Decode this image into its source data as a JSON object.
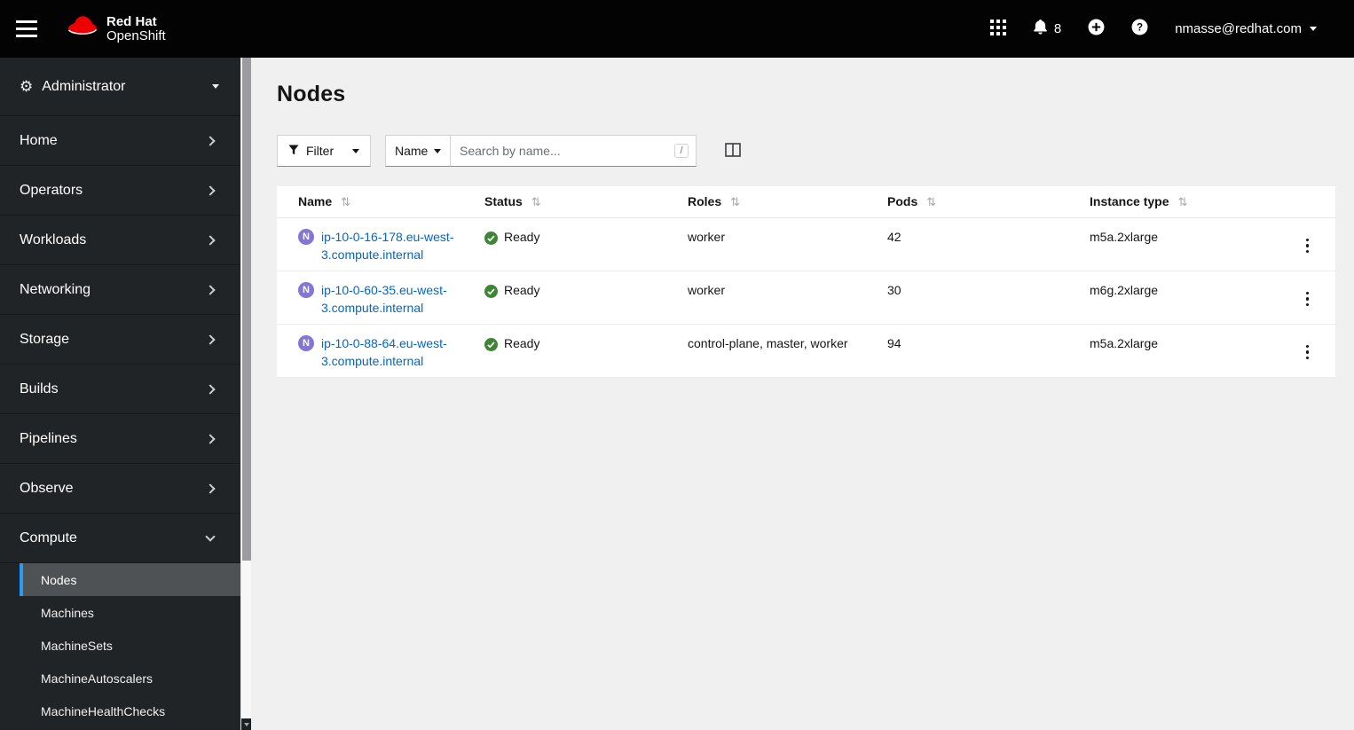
{
  "colors": {
    "brand_red": "#ee0000",
    "link_blue": "#0066cc",
    "ready_green": "#3e8635",
    "node_badge_purple": "#8476d1",
    "nav_selected_border": "#2b9af3"
  },
  "header": {
    "brand_line1": "Red Hat",
    "brand_line2": "OpenShift",
    "notification_count": "8",
    "user_menu": "nmasse@redhat.com"
  },
  "sidebar": {
    "perspective": "Administrator",
    "items": [
      {
        "label": "Home"
      },
      {
        "label": "Operators"
      },
      {
        "label": "Workloads"
      },
      {
        "label": "Networking"
      },
      {
        "label": "Storage"
      },
      {
        "label": "Builds"
      },
      {
        "label": "Pipelines"
      },
      {
        "label": "Observe"
      },
      {
        "label": "Compute",
        "expanded": true,
        "children": [
          {
            "label": "Nodes",
            "selected": true
          },
          {
            "label": "Machines"
          },
          {
            "label": "MachineSets"
          },
          {
            "label": "MachineAutoscalers"
          },
          {
            "label": "MachineHealthChecks"
          }
        ]
      }
    ]
  },
  "page": {
    "title": "Nodes",
    "toolbar": {
      "filter_label": "Filter",
      "name_filter_label": "Name",
      "search_placeholder": "Search by name...",
      "search_shortcut": "/"
    },
    "table": {
      "columns": [
        "Name",
        "Status",
        "Roles",
        "Pods",
        "Instance type"
      ],
      "rows": [
        {
          "badge": "N",
          "name": "ip-10-0-16-178.eu-west-3.compute.internal",
          "status": "Ready",
          "roles": "worker",
          "pods": "42",
          "instance_type": "m5a.2xlarge"
        },
        {
          "badge": "N",
          "name": "ip-10-0-60-35.eu-west-3.compute.internal",
          "status": "Ready",
          "roles": "worker",
          "pods": "30",
          "instance_type": "m6g.2xlarge"
        },
        {
          "badge": "N",
          "name": "ip-10-0-88-64.eu-west-3.compute.internal",
          "status": "Ready",
          "roles": "control-plane, master, worker",
          "pods": "94",
          "instance_type": "m5a.2xlarge"
        }
      ]
    }
  }
}
